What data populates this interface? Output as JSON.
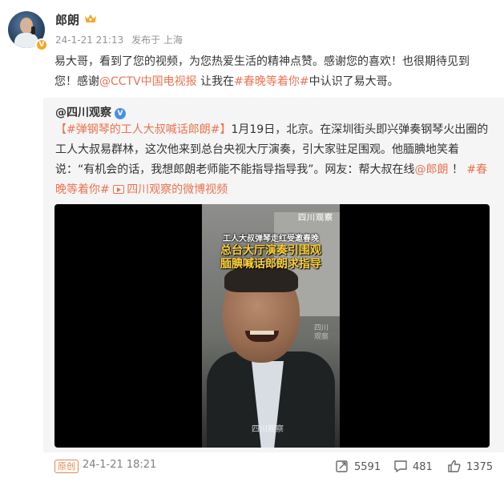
{
  "post": {
    "author": "郎朗",
    "badge_letter": "V",
    "time": "24-1-21 21:13",
    "source": "发布于 上海",
    "text_parts": {
      "p1": "易大哥，看到了您的视频，为您热爱生活的精神点赞。感谢您的喜欢！也很期待见到您！感谢",
      "mention": "@CCTV中国电视报",
      "p2": " 让我在",
      "topic": "#春晚等着你#",
      "p3": "中认识了易大哥。"
    }
  },
  "retweet": {
    "author": "@四川观察",
    "verified": "V",
    "text_parts": {
      "topic1": "【#弹钢琴的工人大叔喊话郎朗#】",
      "t1": "1月19日，北京。在深圳街头即兴弹奏钢琴火出圈的工人大叔易群林，这次他来到总台央视大厅演奏，引大家驻足围观。他腼腆地笑着说：“有机会的话，我想郎朗老师能不能指导指导我”。网友：帮大叔在线",
      "mention": "@郎朗",
      "t2": " ！ ",
      "topic2": "#春晚等着你#",
      "t3": " ",
      "video_link": "四川观察的微博视频"
    },
    "video": {
      "caption_line1": "工人大叔弹琴走红受邀春晚",
      "caption_line2": "总台大厅演奏引围观",
      "caption_line3": "腼腆喊话郎朗求指导",
      "watermark_top": "四川观察",
      "watermark_mid_1": "四川",
      "watermark_mid_2": "观察",
      "watermark_bottom": "四川观察"
    }
  },
  "footer": {
    "original_badge": "原创",
    "date": "24-1-21 18:21",
    "shares": "5591",
    "comments": "481",
    "likes": "1375"
  },
  "colors": {
    "link": "#eb7350",
    "retweet_bg": "#f5f5f5",
    "meta_gray": "#939393"
  },
  "icons": [
    "verified-badge-icon",
    "crown-icon",
    "blue-v-icon",
    "video-link-icon",
    "share-icon",
    "comment-icon",
    "like-icon"
  ]
}
